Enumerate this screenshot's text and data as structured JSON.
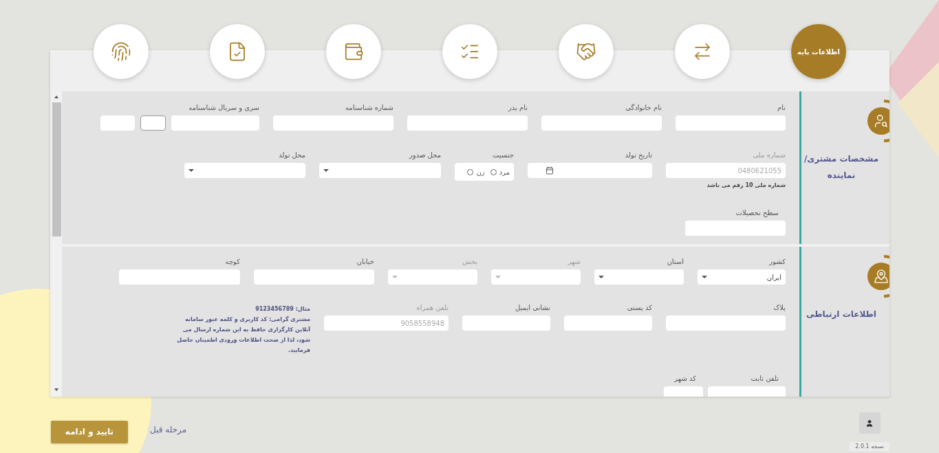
{
  "steps": [
    {
      "kind": "basic",
      "label": "اطلاعات پایه",
      "selected": true
    },
    {
      "kind": "exchange",
      "selected": false
    },
    {
      "kind": "handshake",
      "selected": false
    },
    {
      "kind": "checklist",
      "selected": false
    },
    {
      "kind": "wallet",
      "selected": false
    },
    {
      "kind": "document",
      "selected": false
    },
    {
      "kind": "fingerprint",
      "selected": false
    }
  ],
  "sections": [
    {
      "title": "مشخصات مشتری/نماینده",
      "kind": "person",
      "groups": [
        {
          "fields": [
            {
              "label": "نام",
              "kind": "text",
              "disabled": false
            },
            {
              "label": "نام خانوادگی",
              "kind": "text",
              "disabled": false
            },
            {
              "label": "نام پدر",
              "kind": "text",
              "disabled": false
            },
            {
              "label": "شماره شناسنامه",
              "kind": "text",
              "disabled": false
            },
            {
              "label": "سری و سریال شناسنامه",
              "kind": "serial",
              "disabled": false
            }
          ]
        },
        {
          "fields": [
            {
              "label": "شماره ملی",
              "kind": "text",
              "placeholder": "0480621055",
              "disabled": true,
              "hint": "شماره ملی 10 رقم می باشد"
            },
            {
              "label": "تاریخ تولد",
              "kind": "date",
              "disabled": false
            },
            {
              "label": "جنسیت",
              "kind": "radio",
              "disabled": false,
              "options": [
                {
                  "label": "مرد",
                  "selected": false
                },
                {
                  "label": "زن",
                  "selected": false
                }
              ]
            },
            {
              "label": "محل صدور",
              "kind": "select",
              "disabled": false
            },
            {
              "label": "محل تولد",
              "kind": "select",
              "disabled": false
            }
          ]
        },
        {
          "fields": [
            {
              "label": "سطح تحصیلات",
              "kind": "text",
              "disabled": false
            }
          ]
        }
      ]
    },
    {
      "title": "اطلاعات ارتباطی",
      "kind": "contact",
      "note": {
        "example": "مثال: 9123456789",
        "text": "مشتری گرامی: کد کاربری و کلمه عبور سامانه آنلاین کارگزاری حافظ به این شماره ارسال می شود، لذا از صحت اطلاعات ورودی اطمینان حاصل فرمایید."
      },
      "groups": [
        {
          "fields": [
            {
              "label": "کشور",
              "kind": "select",
              "value": "ایران",
              "disabled": false
            },
            {
              "label": "استان",
              "kind": "select",
              "disabled": false
            },
            {
              "label": "شهر",
              "kind": "select",
              "disabled": true
            },
            {
              "label": "بخش",
              "kind": "select",
              "disabled": true
            },
            {
              "label": "خیابان",
              "kind": "text",
              "disabled": false
            },
            {
              "label": "کوچه",
              "kind": "text",
              "disabled": false
            }
          ]
        },
        {
          "fields": [
            {
              "label": "پلاک",
              "kind": "text",
              "disabled": false
            },
            {
              "label": "کد پستی",
              "kind": "text",
              "disabled": false
            },
            {
              "label": "نشانی ایمیل",
              "kind": "text",
              "disabled": false
            },
            {
              "label": "تلفن همراه",
              "kind": "text",
              "placeholder": "9058558948",
              "disabled": true
            }
          ]
        },
        {
          "fields": [
            {
              "label": "تلفن ثابت",
              "kind": "text",
              "disabled": false
            },
            {
              "label": "کد شهر",
              "kind": "text",
              "disabled": false
            }
          ]
        }
      ]
    }
  ],
  "footer": {
    "primary_button": "تایید و ادامه",
    "back_link": "مرحله قبل",
    "version": "نسخه 2.0.1"
  }
}
